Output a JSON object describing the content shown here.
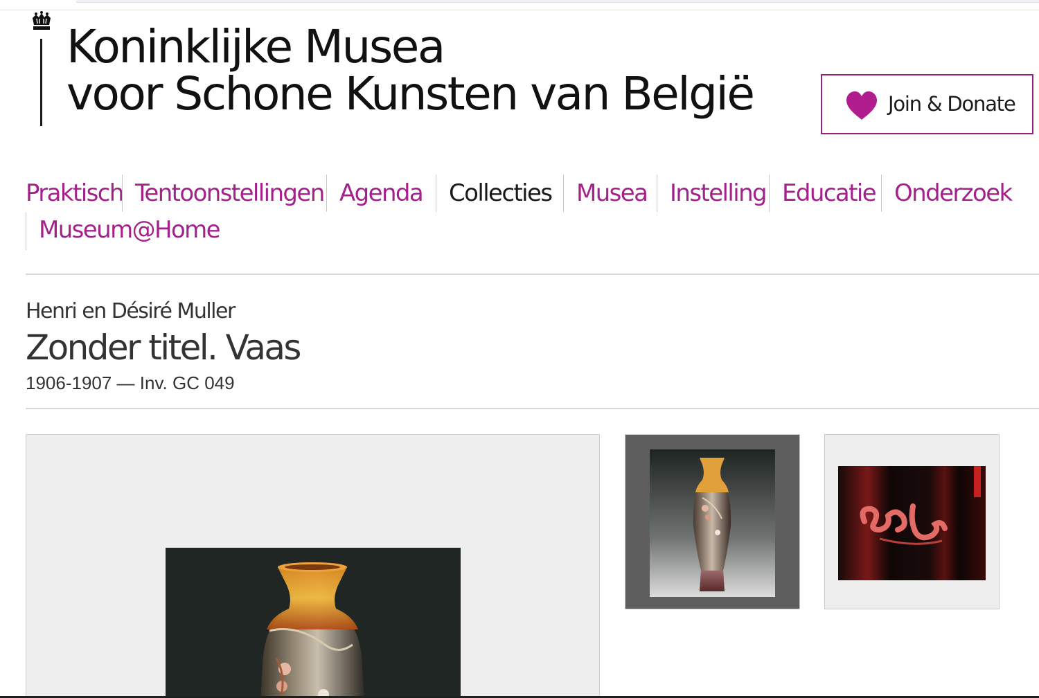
{
  "header": {
    "logo_line1": "Koninklijke Musea",
    "logo_line2": "voor Schone Kunsten van België",
    "donate_label": "Join & Donate"
  },
  "nav": {
    "items": [
      {
        "label": "Praktisch",
        "active": false
      },
      {
        "label": "Tentoonstellingen",
        "active": false
      },
      {
        "label": "Agenda",
        "active": false
      },
      {
        "label": "Collecties",
        "active": true
      },
      {
        "label": "Musea",
        "active": false
      },
      {
        "label": "Instelling",
        "active": false
      },
      {
        "label": "Educatie",
        "active": false
      },
      {
        "label": "Onderzoek",
        "active": false
      },
      {
        "label": "Museum@Home",
        "active": false
      }
    ]
  },
  "artwork": {
    "artist": "Henri en Désiré Muller",
    "title": "Zonder titel. Vaas",
    "meta": "1906-1907 — Inv. GC 049"
  },
  "colors": {
    "brand": "#a3218a",
    "heart": "#b01e8e",
    "text": "#1a1a1a"
  },
  "icons": {
    "logo": "crown-icon",
    "donate": "heart-icon"
  }
}
